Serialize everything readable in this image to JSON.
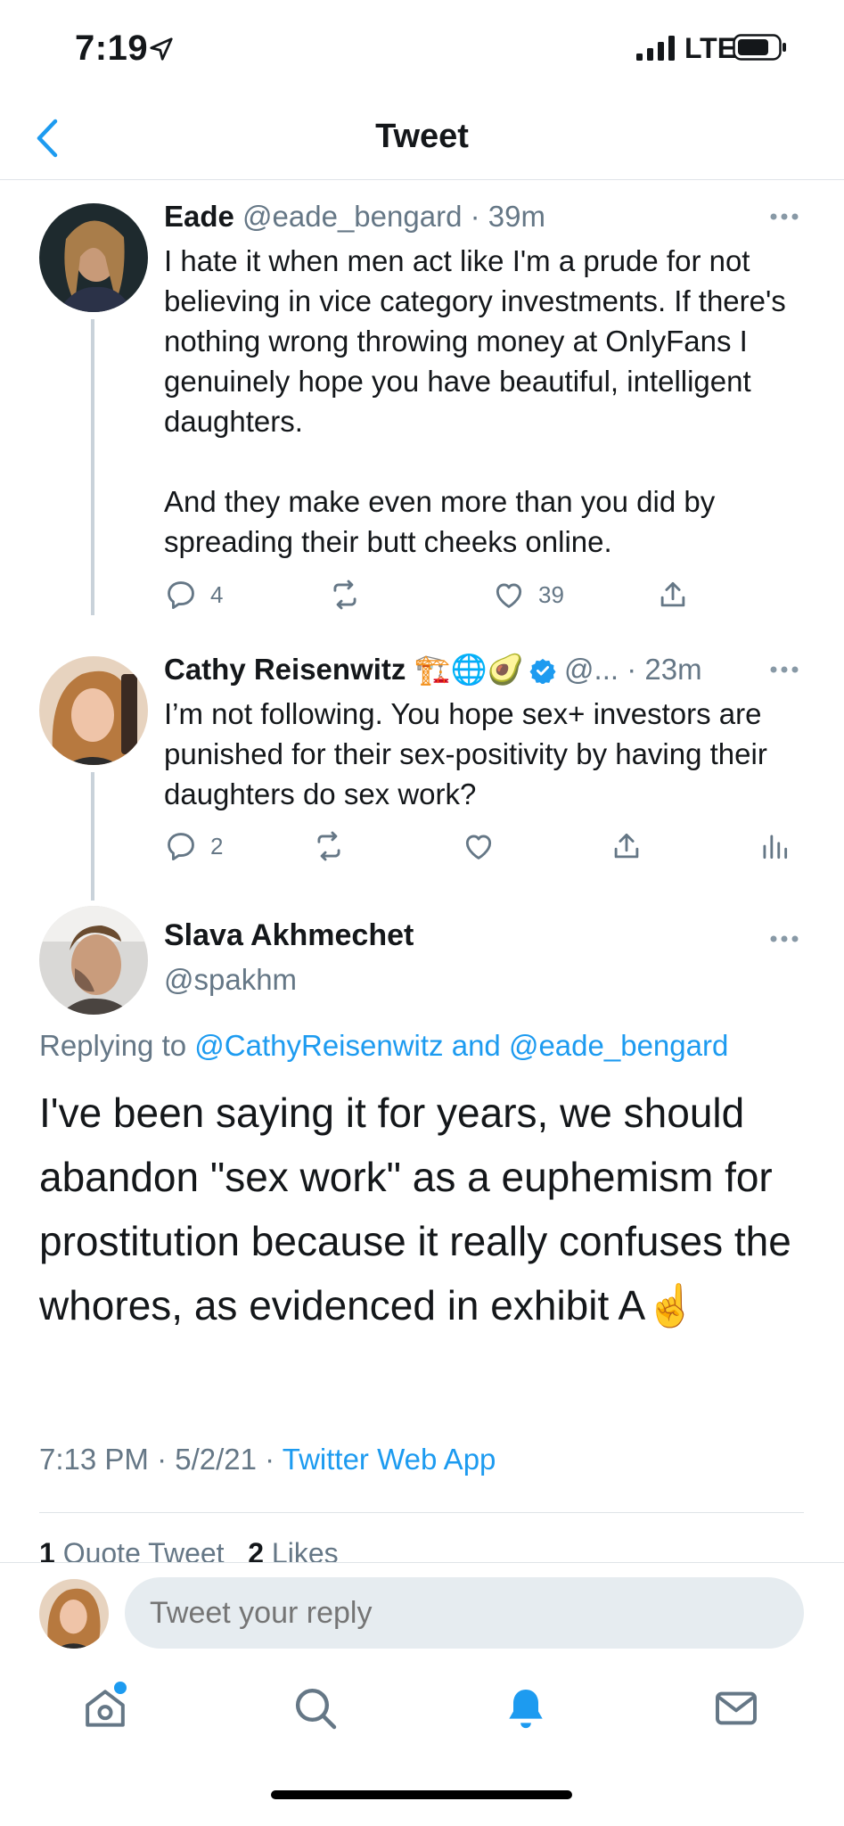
{
  "status_bar": {
    "time": "7:19",
    "network": "LTE"
  },
  "nav": {
    "title": "Tweet",
    "back_icon": "chevron-left-icon"
  },
  "tweets": [
    {
      "name": "Eade",
      "handle": "@eade_bengard",
      "time": "· 39m",
      "text": "I hate it when men act like I'm a prude for not believing in vice category investments. If there's nothing wrong throwing money at OnlyFans I genuinely hope you have beautiful, intelligent daughters.\n\nAnd they make even more than you did by spreading their butt cheeks online.",
      "reply_count": "4",
      "retweet_count": "",
      "like_count": "39"
    },
    {
      "name": "Cathy Reisenwitz",
      "emojis": "🏗️🌐🥑",
      "verified": true,
      "handle": "@...",
      "time": "· 23m",
      "text": "I’m not following. You hope sex+ investors are punished for their sex-positivity by having their daughters do sex work?",
      "reply_count": "2",
      "retweet_count": "",
      "like_count": ""
    }
  ],
  "main_tweet": {
    "name": "Slava Akhmechet",
    "handle": "@spakhm",
    "replying_prefix": "Replying to",
    "replying_user1": "@CathyReisenwitz",
    "replying_and": "and",
    "replying_user2": "@eade_bengard",
    "text": "I've been saying it for years, we should abandon \"sex work\" as a euphemism for prostitution because it really confuses the whores, as evidenced in exhibit A",
    "text_emoji": "☝️",
    "time": "7:13 PM",
    "date": "5/2/21",
    "source": "Twitter Web App",
    "quote_count": "1",
    "quote_label": "Quote Tweet",
    "like_count": "2",
    "like_label": "Likes"
  },
  "reply_bar": {
    "placeholder": "Tweet your reply"
  },
  "tabbar": {
    "items": [
      "home-icon",
      "search-icon",
      "bell-icon",
      "mail-icon"
    ]
  },
  "colors": {
    "accent": "#1d9bf0",
    "muted": "#657786",
    "thread_line": "#c9d2da"
  }
}
